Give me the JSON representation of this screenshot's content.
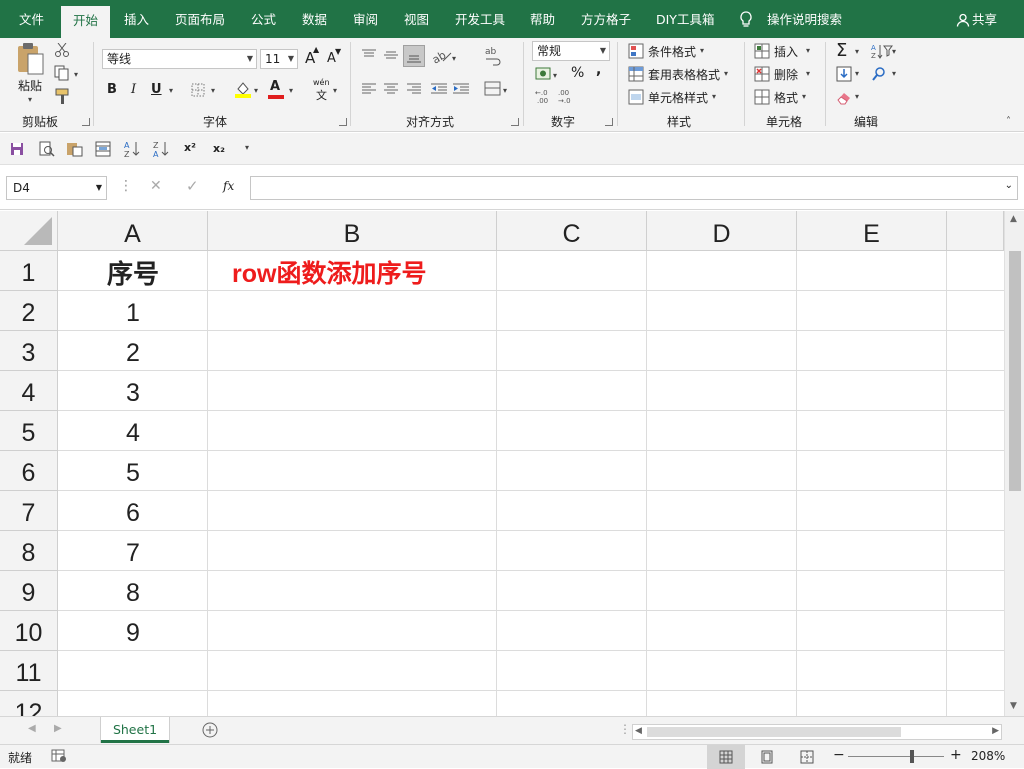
{
  "tabs": [
    {
      "label": "文件"
    },
    {
      "label": "开始"
    },
    {
      "label": "插入"
    },
    {
      "label": "页面布局"
    },
    {
      "label": "公式"
    },
    {
      "label": "数据"
    },
    {
      "label": "审阅"
    },
    {
      "label": "视图"
    },
    {
      "label": "开发工具"
    },
    {
      "label": "帮助"
    },
    {
      "label": "方方格子"
    },
    {
      "label": "DIY工具箱"
    },
    {
      "label": "操作说明搜索"
    }
  ],
  "share_label": "共享",
  "ribbon": {
    "clipboard": {
      "paste_label": "粘贴",
      "group_label": "剪贴板"
    },
    "font": {
      "font_name": "等线",
      "font_size": "11",
      "group_label": "字体",
      "bold": "B",
      "italic": "I",
      "underline": "U",
      "grow": "A",
      "shrink": "A",
      "font_color": "A",
      "phonetic_top": "wén",
      "phonetic_bottom": "文"
    },
    "alignment": {
      "group_label": "对齐方式"
    },
    "number": {
      "format": "常规",
      "group_label": "数字",
      "percent": "%",
      "comma": ","
    },
    "styles": {
      "conditional": "条件格式",
      "table": "套用表格格式",
      "cell_styles": "单元格样式",
      "group_label": "样式"
    },
    "cells": {
      "insert": "插入",
      "delete": "删除",
      "format": "格式",
      "group_label": "单元格"
    },
    "editing": {
      "sum": "Σ",
      "group_label": "编辑"
    }
  },
  "qat": {
    "superscript": "x²",
    "subscript": "x₂"
  },
  "formula_bar": {
    "name_box": "D4",
    "fx": "fx",
    "formula": ""
  },
  "columns": [
    "A",
    "B",
    "C",
    "D",
    "E"
  ],
  "rows": [
    "1",
    "2",
    "3",
    "4",
    "5",
    "6",
    "7",
    "8",
    "9",
    "10",
    "11",
    "12"
  ],
  "cells": {
    "A1": "序号",
    "B1": "row函数添加序号",
    "A2": "1",
    "A3": "2",
    "A4": "3",
    "A5": "4",
    "A6": "5",
    "A7": "6",
    "A8": "7",
    "A9": "8",
    "A10": "9"
  },
  "sheet_tab": "Sheet1",
  "status": {
    "ready": "就绪",
    "zoom": "208%"
  },
  "colors": {
    "brand": "#217346",
    "red_text": "#ee1c1c"
  }
}
